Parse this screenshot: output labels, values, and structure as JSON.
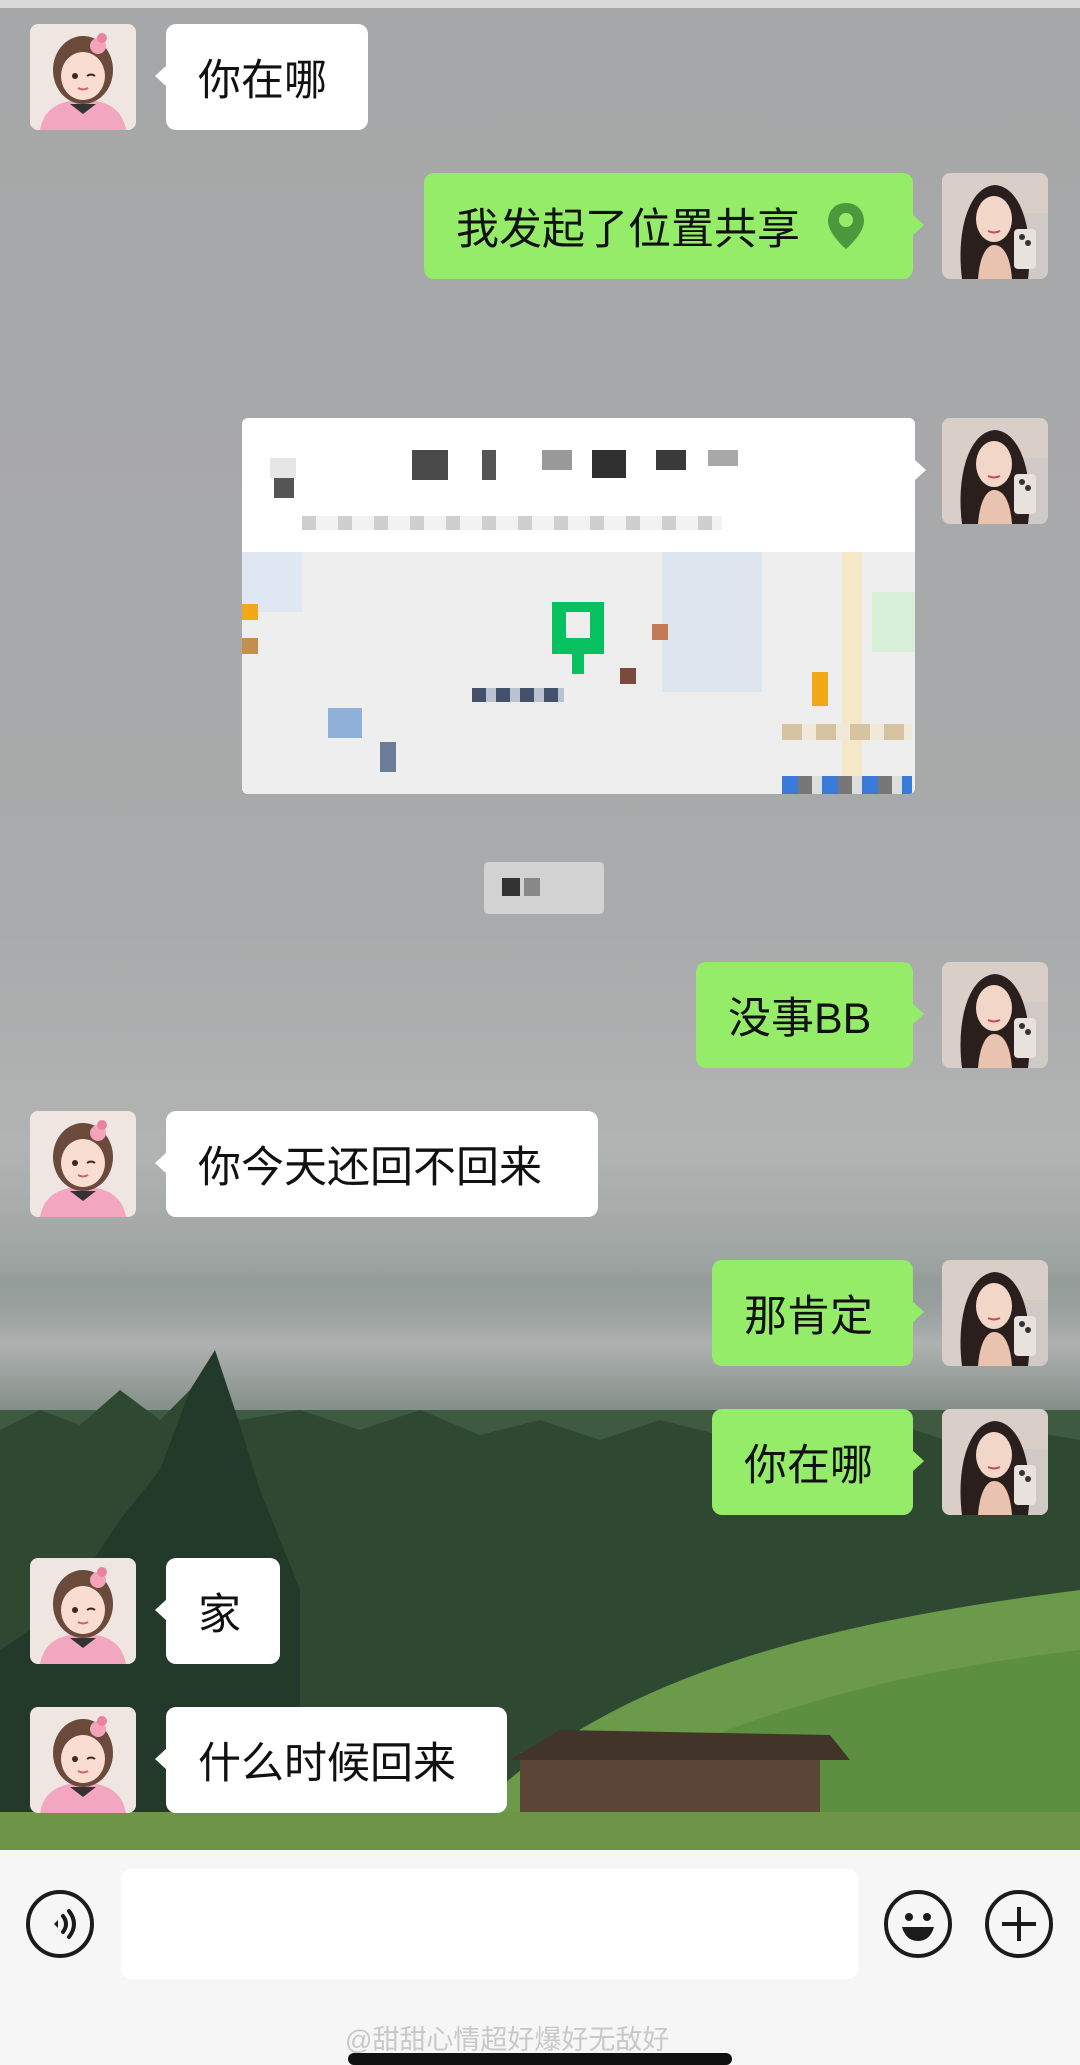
{
  "chat": {
    "messages": [
      {
        "sender": "contact",
        "text": "你在哪"
      },
      {
        "sender": "me",
        "text": "我发起了位置共享",
        "icon": "location-pin-icon"
      },
      {
        "sender": "me",
        "type": "location-card"
      },
      {
        "sender": "me",
        "text": "没事BB"
      },
      {
        "sender": "contact",
        "text": "你今天还回不回来"
      },
      {
        "sender": "me",
        "text": "那肯定"
      },
      {
        "sender": "me",
        "text": "你在哪"
      },
      {
        "sender": "contact",
        "text": "家"
      },
      {
        "sender": "contact",
        "text": "什么时候回来"
      }
    ]
  },
  "input_bar": {
    "voice_icon": "voice-wave-icon",
    "emoji_icon": "smiley-face-icon",
    "more_icon": "plus-icon",
    "input_value": ""
  },
  "watermark": {
    "text": "@甜甜心情超好爆好无敌好"
  },
  "colors": {
    "outgoing_bubble": "#95ec69",
    "incoming_bubble": "#ffffff",
    "accent": "#07c160"
  }
}
